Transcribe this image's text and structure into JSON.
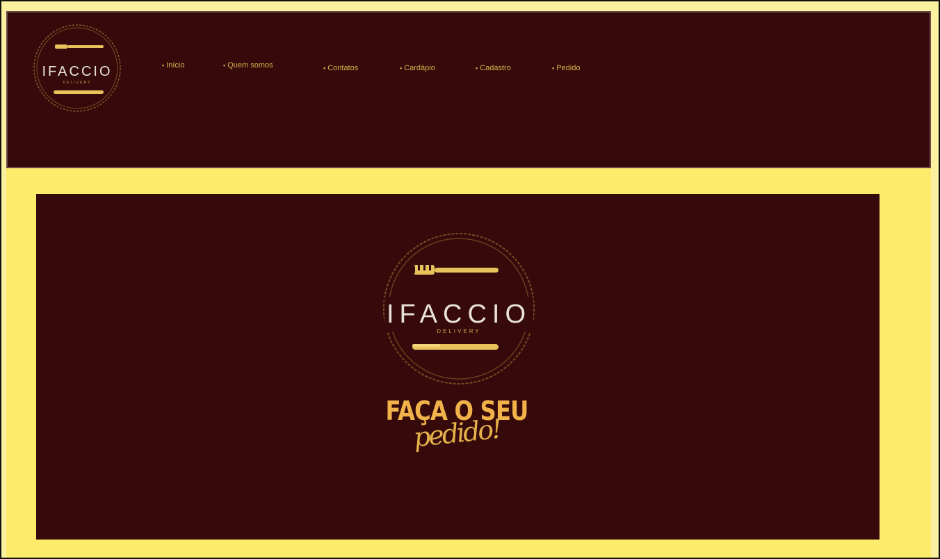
{
  "brand": {
    "name": "IFACCIO",
    "subtitle": "DELIVERY"
  },
  "nav": {
    "items": [
      {
        "label": "Início"
      },
      {
        "label": "Quem somos"
      },
      {
        "label": "Contatos"
      },
      {
        "label": "Cardápio"
      },
      {
        "label": "Cadastro"
      },
      {
        "label": "Pedido"
      }
    ]
  },
  "hero": {
    "cta_main": "FAÇA O SEU",
    "cta_script": "pedido!"
  },
  "colors": {
    "header_bg": "#360a0b",
    "page_bg": "#fdeb6c",
    "gold": "#e8c25a",
    "accent": "#f1b24a"
  },
  "icons": [
    "fork-icon",
    "knife-icon",
    "bullet-icon"
  ]
}
